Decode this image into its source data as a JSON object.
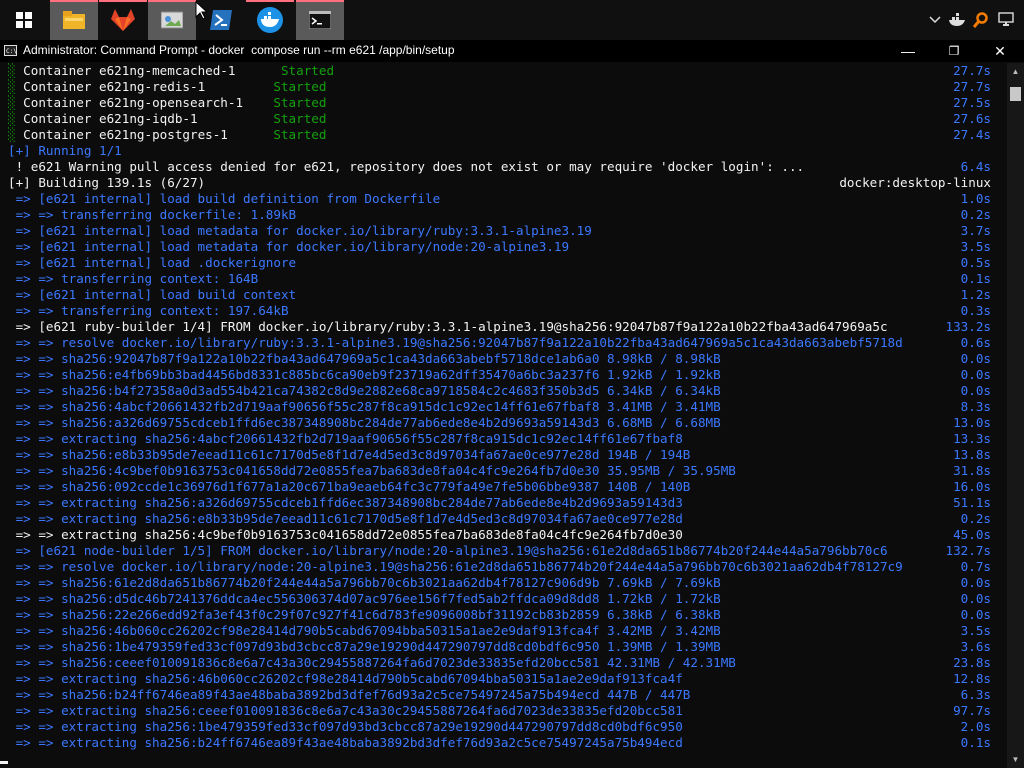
{
  "window": {
    "title": "Administrator: Command Prompt - docker  compose run --rm e621 /app/bin/setup",
    "minimize_glyph": "—",
    "maximize_glyph": "❐",
    "close_glyph": "✕"
  },
  "taskbar": {
    "apps": [
      {
        "name": "start-icon",
        "active": false
      },
      {
        "name": "file-explorer-icon",
        "active": true
      },
      {
        "name": "git-icon",
        "active": false
      },
      {
        "name": "paint-icon",
        "active": true
      },
      {
        "name": "powershell-icon",
        "active": false
      },
      {
        "name": "docker-desktop-icon",
        "active": false
      },
      {
        "name": "command-prompt-icon",
        "active": true
      }
    ],
    "tray": [
      "chevron-up-icon",
      "docker-tray-icon",
      "search-tool-icon",
      "network-icon"
    ]
  },
  "colors": {
    "blue": "#3b78ff",
    "white": "#f2f2f2",
    "green": "#13a10e",
    "background": "#0c0c0c"
  },
  "console": {
    "lines": [
      {
        "text": "░ Container e621ng-memcached-1      Started",
        "time": "27.7s",
        "color": "white",
        "status": "Started"
      },
      {
        "text": "░ Container e621ng-redis-1         Started",
        "time": "27.7s",
        "color": "white",
        "status": "Started"
      },
      {
        "text": "░ Container e621ng-opensearch-1    Started",
        "time": "27.5s",
        "color": "white",
        "status": "Started"
      },
      {
        "text": "░ Container e621ng-iqdb-1          Started",
        "time": "27.6s",
        "color": "white",
        "status": "Started"
      },
      {
        "text": "░ Container e621ng-postgres-1      Started",
        "time": "27.4s",
        "color": "white",
        "status": "Started"
      },
      {
        "text": "[+] Running 1/1",
        "time": "",
        "color": "blue"
      },
      {
        "text": " ! e621 Warning pull access denied for e621, repository does not exist or may require 'docker login': ...",
        "time": "6.4s",
        "color": "white"
      },
      {
        "text": "[+] Building 139.1s (6/27)",
        "time": "docker:desktop-linux",
        "color": "white"
      },
      {
        "text": " => [e621 internal] load build definition from Dockerfile",
        "time": "1.0s",
        "color": "blue"
      },
      {
        "text": " => => transferring dockerfile: 1.89kB",
        "time": "0.2s",
        "color": "blue"
      },
      {
        "text": " => [e621 internal] load metadata for docker.io/library/ruby:3.3.1-alpine3.19",
        "time": "3.7s",
        "color": "blue"
      },
      {
        "text": " => [e621 internal] load metadata for docker.io/library/node:20-alpine3.19",
        "time": "3.5s",
        "color": "blue"
      },
      {
        "text": " => [e621 internal] load .dockerignore",
        "time": "0.5s",
        "color": "blue"
      },
      {
        "text": " => => transferring context: 164B",
        "time": "0.1s",
        "color": "blue"
      },
      {
        "text": " => [e621 internal] load build context",
        "time": "1.2s",
        "color": "blue"
      },
      {
        "text": " => => transferring context: 197.64kB",
        "time": "0.3s",
        "color": "blue"
      },
      {
        "text": " => [e621 ruby-builder 1/4] FROM docker.io/library/ruby:3.3.1-alpine3.19@sha256:92047b87f9a122a10b22fba43ad647969a5c",
        "time": "133.2s",
        "color": "white"
      },
      {
        "text": " => => resolve docker.io/library/ruby:3.3.1-alpine3.19@sha256:92047b87f9a122a10b22fba43ad647969a5c1ca43da663abebf5718d",
        "time": "0.6s",
        "color": "blue"
      },
      {
        "text": " => => sha256:92047b87f9a122a10b22fba43ad647969a5c1ca43da663abebf5718dce1ab6a0 8.98kB / 8.98kB",
        "time": "0.0s",
        "color": "blue"
      },
      {
        "text": " => => sha256:e4fb69bb3bad4456bd8331c885bc6ca90eb9f23719a62dff35470a6bc3a237f6 1.92kB / 1.92kB",
        "time": "0.0s",
        "color": "blue"
      },
      {
        "text": " => => sha256:b4f27358a0d3ad554b421ca74382c8d9e2882e68ca9718584c2c4683f350b3d5 6.34kB / 6.34kB",
        "time": "0.0s",
        "color": "blue"
      },
      {
        "text": " => => sha256:4abcf20661432fb2d719aaf90656f55c287f8ca915dc1c92ec14ff61e67fbaf8 3.41MB / 3.41MB",
        "time": "8.3s",
        "color": "blue"
      },
      {
        "text": " => => sha256:a326d69755cdceb1ffd6ec387348908bc284de77ab6ede8e4b2d9693a59143d3 6.68MB / 6.68MB",
        "time": "13.0s",
        "color": "blue"
      },
      {
        "text": " => => extracting sha256:4abcf20661432fb2d719aaf90656f55c287f8ca915dc1c92ec14ff61e67fbaf8",
        "time": "13.3s",
        "color": "blue"
      },
      {
        "text": " => => sha256:e8b33b95de7eead11c61c7170d5e8f1d7e4d5ed3c8d97034fa67ae0ce977e28d 194B / 194B",
        "time": "13.8s",
        "color": "blue"
      },
      {
        "text": " => => sha256:4c9bef0b9163753c041658dd72e0855fea7ba683de8fa04c4fc9e264fb7d0e30 35.95MB / 35.95MB",
        "time": "31.8s",
        "color": "blue"
      },
      {
        "text": " => => sha256:092ccde1c36976d1f677a1a20c671ba9eaeb64fc3c779fa49e7fe5b06bbe9387 140B / 140B",
        "time": "16.0s",
        "color": "blue"
      },
      {
        "text": " => => extracting sha256:a326d69755cdceb1ffd6ec387348908bc284de77ab6ede8e4b2d9693a59143d3",
        "time": "51.1s",
        "color": "blue"
      },
      {
        "text": " => => extracting sha256:e8b33b95de7eead11c61c7170d5e8f1d7e4d5ed3c8d97034fa67ae0ce977e28d",
        "time": "0.2s",
        "color": "blue"
      },
      {
        "text": " => => extracting sha256:4c9bef0b9163753c041658dd72e0855fea7ba683de8fa04c4fc9e264fb7d0e30",
        "time": "45.0s",
        "color": "white"
      },
      {
        "text": " => [e621 node-builder 1/5] FROM docker.io/library/node:20-alpine3.19@sha256:61e2d8da651b86774b20f244e44a5a796bb70c6",
        "time": "132.7s",
        "color": "blue"
      },
      {
        "text": " => => resolve docker.io/library/node:20-alpine3.19@sha256:61e2d8da651b86774b20f244e44a5a796bb70c6b3021aa62db4f78127c9",
        "time": "0.7s",
        "color": "blue"
      },
      {
        "text": " => => sha256:61e2d8da651b86774b20f244e44a5a796bb70c6b3021aa62db4f78127c906d9b 7.69kB / 7.69kB",
        "time": "0.0s",
        "color": "blue"
      },
      {
        "text": " => => sha256:d5dc46b7241376ddca4ec556306374d07ac976ee156f7fed5ab2ffdca09d8dd8 1.72kB / 1.72kB",
        "time": "0.0s",
        "color": "blue"
      },
      {
        "text": " => => sha256:22e266edd92fa3ef43f0c29f07c927f41c6d783fe9096008bf31192cb83b2859 6.38kB / 6.38kB",
        "time": "0.0s",
        "color": "blue"
      },
      {
        "text": " => => sha256:46b060cc26202cf98e28414d790b5cabd67094bba50315a1ae2e9daf913fca4f 3.42MB / 3.42MB",
        "time": "3.5s",
        "color": "blue"
      },
      {
        "text": " => => sha256:1be479359fed33cf097d93bd3cbcc87a29e19290d447290797dd8cd0bdf6c950 1.39MB / 1.39MB",
        "time": "3.6s",
        "color": "blue"
      },
      {
        "text": " => => sha256:ceeef010091836c8e6a7c43a30c29455887264fa6d7023de33835efd20bcc581 42.31MB / 42.31MB",
        "time": "23.8s",
        "color": "blue"
      },
      {
        "text": " => => extracting sha256:46b060cc26202cf98e28414d790b5cabd67094bba50315a1ae2e9daf913fca4f",
        "time": "12.8s",
        "color": "blue"
      },
      {
        "text": " => => sha256:b24ff6746ea89f43ae48baba3892bd3dfef76d93a2c5ce75497245a75b494ecd 447B / 447B",
        "time": "6.3s",
        "color": "blue"
      },
      {
        "text": " => => extracting sha256:ceeef010091836c8e6a7c43a30c29455887264fa6d7023de33835efd20bcc581",
        "time": "97.7s",
        "color": "blue"
      },
      {
        "text": " => => extracting sha256:1be479359fed33cf097d93bd3cbcc87a29e19290d447290797dd8cd0bdf6c950",
        "time": "2.0s",
        "color": "blue"
      },
      {
        "text": " => => extracting sha256:b24ff6746ea89f43ae48baba3892bd3dfef76d93a2c5ce75497245a75b494ecd",
        "time": "0.1s",
        "color": "blue"
      }
    ]
  }
}
